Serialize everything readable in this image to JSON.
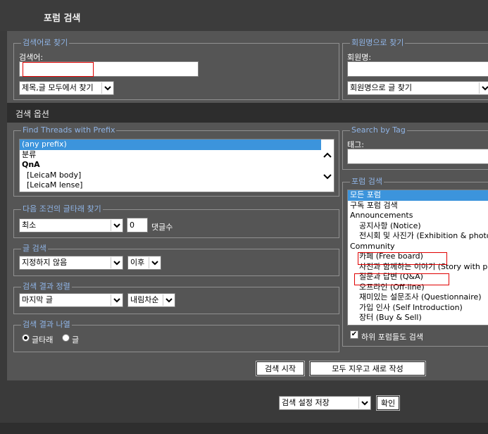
{
  "header": {
    "title": "포럼 검색"
  },
  "keyword": {
    "legend": "검색어로 찾기",
    "label": "검색어:",
    "value": "",
    "scope_select": "제목,글 모두에서 찾기"
  },
  "member": {
    "legend": "회원명으로 찾기",
    "label": "회원명:",
    "value": "",
    "mode_select": "회원명으로 글 찾기"
  },
  "options_header": "검색 옵션",
  "prefix": {
    "legend": "Find Threads with Prefix",
    "items": [
      {
        "label": "(any prefix)",
        "selected": true
      },
      {
        "label": "분류"
      },
      {
        "label": "QnA",
        "bold": true
      },
      {
        "label": "[LeicaM body]"
      },
      {
        "label": "[LeicaM lense]"
      }
    ]
  },
  "tag": {
    "legend": "Search by Tag",
    "label": "태그:",
    "value": ""
  },
  "replies": {
    "legend": "다음 조건의 글타래 찾기",
    "condition_select": "최소",
    "count_value": "0",
    "suffix": "댓글수"
  },
  "date": {
    "legend": "글 검색",
    "range_select": "지정하지 않음",
    "direction_select": "이후"
  },
  "sort": {
    "legend": "검색 결과 정렬",
    "field_select": "마지막 글",
    "order_select": "내림차순"
  },
  "display": {
    "legend": "검색 결과 나열",
    "option_threads": "글타래",
    "option_posts": "글",
    "selected": "threads"
  },
  "forums": {
    "legend": "포럼 검색",
    "items": [
      {
        "label": "모든 포럼",
        "selected": true
      },
      {
        "label": "구독 포럼 검색"
      },
      {
        "label": "Announcements"
      },
      {
        "label": "공지사항 (Notice)",
        "indent": 2
      },
      {
        "label": "전시회 및 사진가 (Exhibition & photographer)",
        "indent": 2
      },
      {
        "label": "Community"
      },
      {
        "label": "카페 (Free board)",
        "indent": 2
      },
      {
        "label": "사진과 함께하는 이야기 (Story with photo)",
        "indent": 2
      },
      {
        "label": "질문과 답변 (Q&A)",
        "indent": 2
      },
      {
        "label": "오프라인 (Off-line)",
        "indent": 2
      },
      {
        "label": "재미있는 설문조사 (Questionnaire)",
        "indent": 2
      },
      {
        "label": "가입 인사 (Self Introduction)",
        "indent": 2
      },
      {
        "label": "장터 (Buy & Sell)",
        "indent": 2
      }
    ],
    "child_label": "하위 포럼들도 검색",
    "child_checked": true
  },
  "buttons": {
    "search": "검색 시작",
    "reset": "모두 지우고 새로 작성"
  },
  "save": {
    "select": "검색 설정 저장",
    "ok": "확인"
  }
}
